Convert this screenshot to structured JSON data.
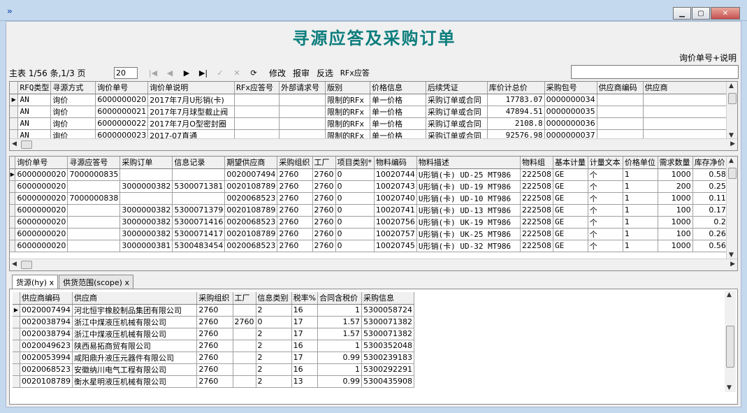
{
  "window": {
    "title": "寻源应答及采购订单",
    "controls": [
      "minimize",
      "maximize",
      "close"
    ]
  },
  "rfq_search": {
    "label": "询价单号+说明",
    "value": ""
  },
  "toolbar": {
    "record_info": "主表 1/56 条,1/3 页",
    "page_size": "20",
    "buttons": [
      {
        "name": "first-record-button",
        "glyph": "|◀",
        "enabled": false
      },
      {
        "name": "prev-record-button",
        "glyph": "◀",
        "enabled": false
      },
      {
        "name": "next-record-button",
        "glyph": "▶",
        "enabled": true
      },
      {
        "name": "last-record-button",
        "glyph": "▶|",
        "enabled": true
      },
      {
        "name": "confirm-button",
        "glyph": "✓",
        "enabled": false
      },
      {
        "name": "cancel-button",
        "glyph": "✕",
        "enabled": false
      },
      {
        "name": "refresh-button",
        "glyph": "⟳",
        "enabled": true
      }
    ],
    "actions": {
      "edit": "修改",
      "report": "报审",
      "reverse": "反选",
      "rfx": "RFx应答"
    }
  },
  "grid1": {
    "columns": [
      "RFQ类型",
      "寻源方式",
      "询价单号",
      "询价单说明",
      "RFx应答号",
      "外部请求号",
      "版别",
      "价格信息",
      "后续凭证",
      "库价计总价",
      "采购包号",
      "供应商编码",
      "供应商"
    ],
    "rows": [
      [
        "AN",
        "询价",
        "6000000020",
        "2017年7月U形销(卡)",
        "",
        "",
        "限制的RFx",
        "单一价格",
        "采购订单或合同",
        "17783.07",
        "0000000034",
        "",
        ""
      ],
      [
        "AN",
        "询价",
        "6000000021",
        "2017年7月球型截止阀",
        "",
        "",
        "限制的RFx",
        "单一价格",
        "采购订单或合同",
        "47894.51",
        "0000000035",
        "",
        ""
      ],
      [
        "AN",
        "询价",
        "6000000022",
        "2017年7月O型密封圈",
        "",
        "",
        "限制的RFx",
        "单一价格",
        "采购订单或合同",
        "2108.8",
        "0000000036",
        "",
        ""
      ],
      [
        "AN",
        "询价",
        "6000000023",
        "2017-07直通",
        "",
        "",
        "限制的RFx",
        "单一价格",
        "采购订单或合同",
        "92576.98",
        "0000000037",
        "",
        ""
      ]
    ]
  },
  "grid2": {
    "columns": [
      "询价单号",
      "寻源应答号",
      "采购订单",
      "信息记录",
      "期望供应商",
      "采购组织",
      "工厂",
      "项目类别*",
      "物料编码",
      "物料描述",
      "物料组",
      "基本计量",
      "计量文本",
      "价格单位",
      "需求数量",
      "库存净价"
    ],
    "rows": [
      [
        "6000000020",
        "7000000835",
        "",
        "",
        "0020007494",
        "2760",
        "2760",
        "0",
        "10020744",
        "U形销(卡) UD-25 MT986",
        "222508",
        "GE",
        "个",
        "1",
        "1000",
        "0.58"
      ],
      [
        "6000000020",
        "",
        "3000000382",
        "5300071381",
        "0020108789",
        "2760",
        "2760",
        "0",
        "10020743",
        "U形销(卡) UD-19 MT986",
        "222508",
        "GE",
        "个",
        "1",
        "200",
        "0.25"
      ],
      [
        "6000000020",
        "7000000838",
        "",
        "",
        "0020068523",
        "2760",
        "2760",
        "0",
        "10020740",
        "U形销(卡) UD-10 MT986",
        "222508",
        "GE",
        "个",
        "1",
        "1000",
        "0.11"
      ],
      [
        "6000000020",
        "",
        "3000000382",
        "5300071379",
        "0020108789",
        "2760",
        "2760",
        "0",
        "10020741",
        "U形销(卡) UD-13 MT986",
        "222508",
        "GE",
        "个",
        "1",
        "100",
        "0.17"
      ],
      [
        "6000000020",
        "",
        "3000000382",
        "5300071416",
        "0020068523",
        "2760",
        "2760",
        "0",
        "10020756",
        "U形销(卡) UK-19 MT986",
        "222508",
        "GE",
        "个",
        "1",
        "1000",
        "0.2"
      ],
      [
        "6000000020",
        "",
        "3000000382",
        "5300071417",
        "0020108789",
        "2760",
        "2760",
        "0",
        "10020757",
        "U形销(卡) UK-25 MT986",
        "222508",
        "GE",
        "个",
        "1",
        "100",
        "0.26"
      ],
      [
        "6000000020",
        "",
        "3000000381",
        "5300483454",
        "0020068523",
        "2760",
        "2760",
        "0",
        "10020745",
        "U形销(卡) UD-32 MT986",
        "222508",
        "GE",
        "个",
        "1",
        "1000",
        "0.56"
      ]
    ]
  },
  "tabs": [
    {
      "label": "货源(hy)",
      "close": "x",
      "active": true
    },
    {
      "label": "供货范围(scope)",
      "close": "x",
      "active": false
    }
  ],
  "grid3": {
    "columns": [
      "供应商编码",
      "供应商",
      "采购组织",
      "工厂",
      "信息类别",
      "税率%",
      "合同含税价",
      "采购信息"
    ],
    "rows": [
      [
        "0020007494",
        "河北恒宇橡胶制品集团有限公司",
        "2760",
        "",
        "2",
        "16",
        "1",
        "5300058724"
      ],
      [
        "0020038794",
        "浙江中煤液压机械有限公司",
        "2760",
        "2760",
        "0",
        "17",
        "1.57",
        "5300071382"
      ],
      [
        "0020038794",
        "浙江中煤液压机械有限公司",
        "2760",
        "",
        "2",
        "17",
        "1.57",
        "5300071382"
      ],
      [
        "0020049623",
        "陕西易拓商贸有限公司",
        "2760",
        "",
        "2",
        "16",
        "1",
        "5300352048"
      ],
      [
        "0020053994",
        "咸阳鼎升液压元器件有限公司",
        "2760",
        "",
        "2",
        "17",
        "0.99",
        "5300239183"
      ],
      [
        "0020068523",
        "安徽纳川电气工程有限公司",
        "2760",
        "",
        "2",
        "16",
        "1",
        "5300292291"
      ],
      [
        "0020108789",
        "衡水星明液压机械有限公司",
        "2760",
        "",
        "2",
        "13",
        "0.99",
        "5300435908"
      ]
    ]
  }
}
